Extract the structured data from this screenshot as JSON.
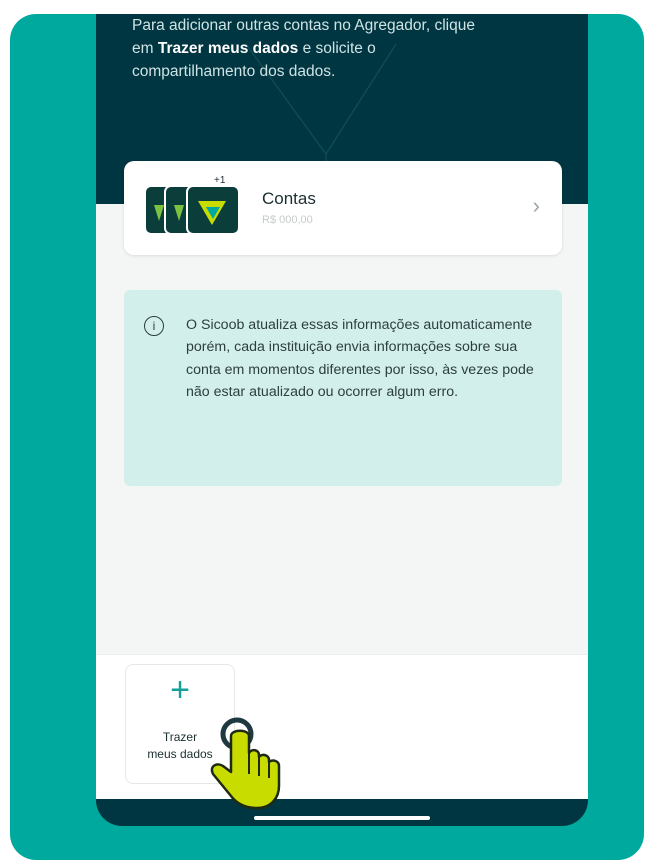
{
  "hero": {
    "line1": "Para adicionar outras contas no Agregador, clique",
    "line2_prefix": "em ",
    "line2_bold": "Trazer meus dados",
    "line2_suffix": " e solicite o",
    "line3": "compartilhamento dos dados."
  },
  "accounts": {
    "title": "Contas",
    "subtitle": "R$ 000,00",
    "badge": "+1"
  },
  "info": {
    "icon": "i",
    "text": "O Sicoob atualiza essas informações automaticamente porém, cada instituição envia informações sobre sua conta em momentos diferentes por isso, às vezes pode não estar atualizado ou ocorrer algum erro."
  },
  "action": {
    "icon": "+",
    "label_line1": "Trazer",
    "label_line2": "meus dados"
  },
  "colors": {
    "frame": "#00a99d",
    "header": "#003641",
    "info_bg": "#d3efec",
    "accent": "#14a09a",
    "hand": "#c9dc00"
  },
  "icons": [
    "info-icon",
    "plus-icon",
    "chevron-right-icon",
    "pointer-hand-icon"
  ]
}
